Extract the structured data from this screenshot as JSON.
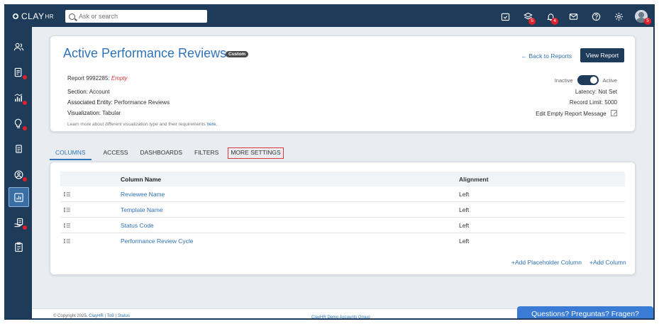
{
  "topbar": {
    "logo": "CLAY",
    "logo_suffix": "HR",
    "search_placeholder": "Ask or search",
    "badges": {
      "layers": "5",
      "bell": "4",
      "avatar": "5"
    }
  },
  "sidebar": {
    "items": [
      {
        "icon": "people-icon",
        "dot": false
      },
      {
        "icon": "report-user-icon",
        "dot": true
      },
      {
        "icon": "bar-chart-icon",
        "dot": true
      },
      {
        "icon": "lightbulb-icon",
        "dot": true
      },
      {
        "icon": "documents-icon",
        "dot": false
      },
      {
        "icon": "user-circle-icon",
        "dot": true
      },
      {
        "icon": "analytics-icon",
        "dot": false,
        "active": true
      },
      {
        "icon": "hand-document-icon",
        "dot": true
      },
      {
        "icon": "clipboard-icon",
        "dot": false
      }
    ]
  },
  "header": {
    "title": "Active Performance Reviews",
    "badge": "Custom",
    "back_link": "← Back to Reports",
    "view_button": "View Report",
    "report_label": "Report",
    "report_id": "9992285:",
    "report_status": "Empty",
    "section_label": "Section:",
    "section_value": "Account",
    "entity_label": "Associated Entity:",
    "entity_value": "Performance Reviews",
    "viz_label": "Visualization:",
    "viz_value": "Tabular",
    "learn_text": "Learn more about different visualization type and their requirements",
    "learn_link": "here.",
    "toggle_off": "Inactive",
    "toggle_on": "Active",
    "latency_label": "Latency:",
    "latency_value": "Not Set",
    "record_label": "Record Limit:",
    "record_value": "5000",
    "edit_message": "Edit Empty Report Message"
  },
  "tabs": [
    {
      "label": "COLUMNS",
      "active": true
    },
    {
      "label": "ACCESS"
    },
    {
      "label": "DASHBOARDS"
    },
    {
      "label": "FILTERS"
    },
    {
      "label": "MORE SETTINGS",
      "highlighted": true
    }
  ],
  "table": {
    "headers": [
      "Column Name",
      "Alignment"
    ],
    "rows": [
      {
        "name": "Reviewee Name",
        "alignment": "Left"
      },
      {
        "name": "Template Name",
        "alignment": "Left"
      },
      {
        "name": "Status Code",
        "alignment": "Left"
      },
      {
        "name": "Performance Review Cycle",
        "alignment": "Left"
      }
    ],
    "add_placeholder": "+Add Placeholder Column",
    "add_column": "+Add Column"
  },
  "footer": {
    "copyright": "© Copyright 2025,",
    "brand_link": "ClayHR",
    "tos": "ToS",
    "status": "Status",
    "center": "ClayHR Demo Accounts Group"
  },
  "chat": {
    "label": "Questions? Preguntas? Fragen?"
  }
}
